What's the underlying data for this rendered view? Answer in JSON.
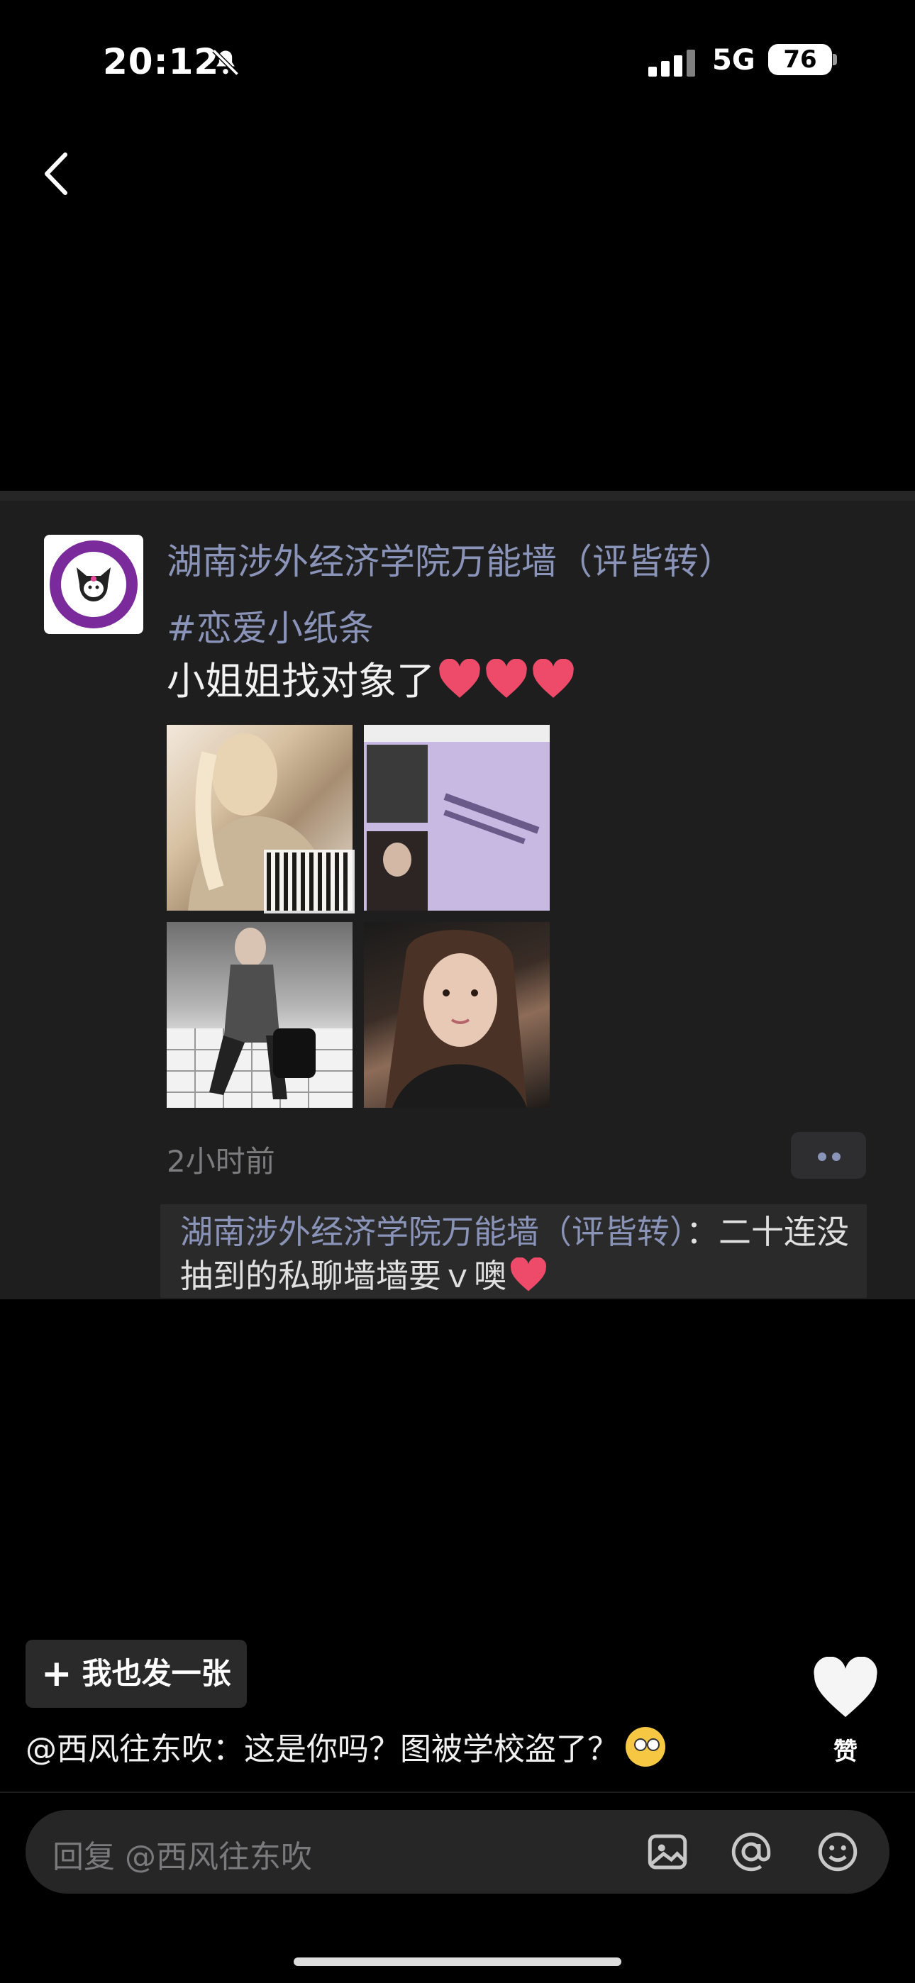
{
  "status_bar": {
    "time": "20:12",
    "network": "5G",
    "battery": "76"
  },
  "post": {
    "author": "湖南涉外经济学院万能墙（评皆转）",
    "hashtag": "#恋爱小纸条",
    "text": "小姐姐找对象了",
    "time_ago": "2小时前",
    "reply_author": "湖南涉外经济学院万能墙（评皆转）",
    "reply_text": "：二十连没抽到的私聊墙墙要ｖ噢"
  },
  "bottom": {
    "post_button_label": "我也发一张",
    "like_label": "赞",
    "comment": "@西风往东吹：这是你吗？图被学校盗了？",
    "input_placeholder": "回复 @西风往东吹"
  },
  "colors": {
    "accent": "#8a93b8",
    "background": "#000000",
    "card": "#1e1e1f"
  },
  "icons": [
    "back-chevron-icon",
    "mute-bell-icon",
    "signal-icon",
    "battery-icon",
    "heart-icon",
    "image-icon",
    "at-icon",
    "emoji-icon",
    "plus-icon"
  ]
}
